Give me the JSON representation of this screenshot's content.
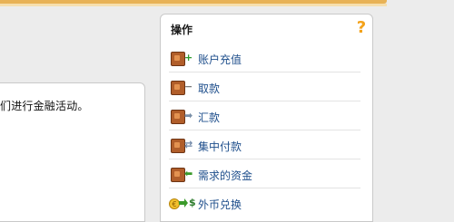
{
  "content": {
    "text": "们进行金融活动。"
  },
  "operations": {
    "title": "操作",
    "help_symbol": "?",
    "items": [
      {
        "label": "账户充值",
        "badge": "+",
        "badge_color": "#2e9b2e"
      },
      {
        "label": "取款",
        "badge": "−",
        "badge_color": "#7a7a7a"
      },
      {
        "label": "汇款",
        "badge": "➡",
        "badge_color": "#7a8fa8"
      },
      {
        "label": "集中付款",
        "badge": "⇄",
        "badge_color": "#6f86a6"
      },
      {
        "label": "需求的资金",
        "badge": "⬅",
        "badge_color": "#3a9a2a"
      },
      {
        "label": "外币兑换",
        "badge": "$",
        "badge_color": "#2a7a2a"
      }
    ]
  },
  "colors": {
    "accent": "#e8b256",
    "link": "#1f4f8c",
    "help": "#f3a21b"
  }
}
